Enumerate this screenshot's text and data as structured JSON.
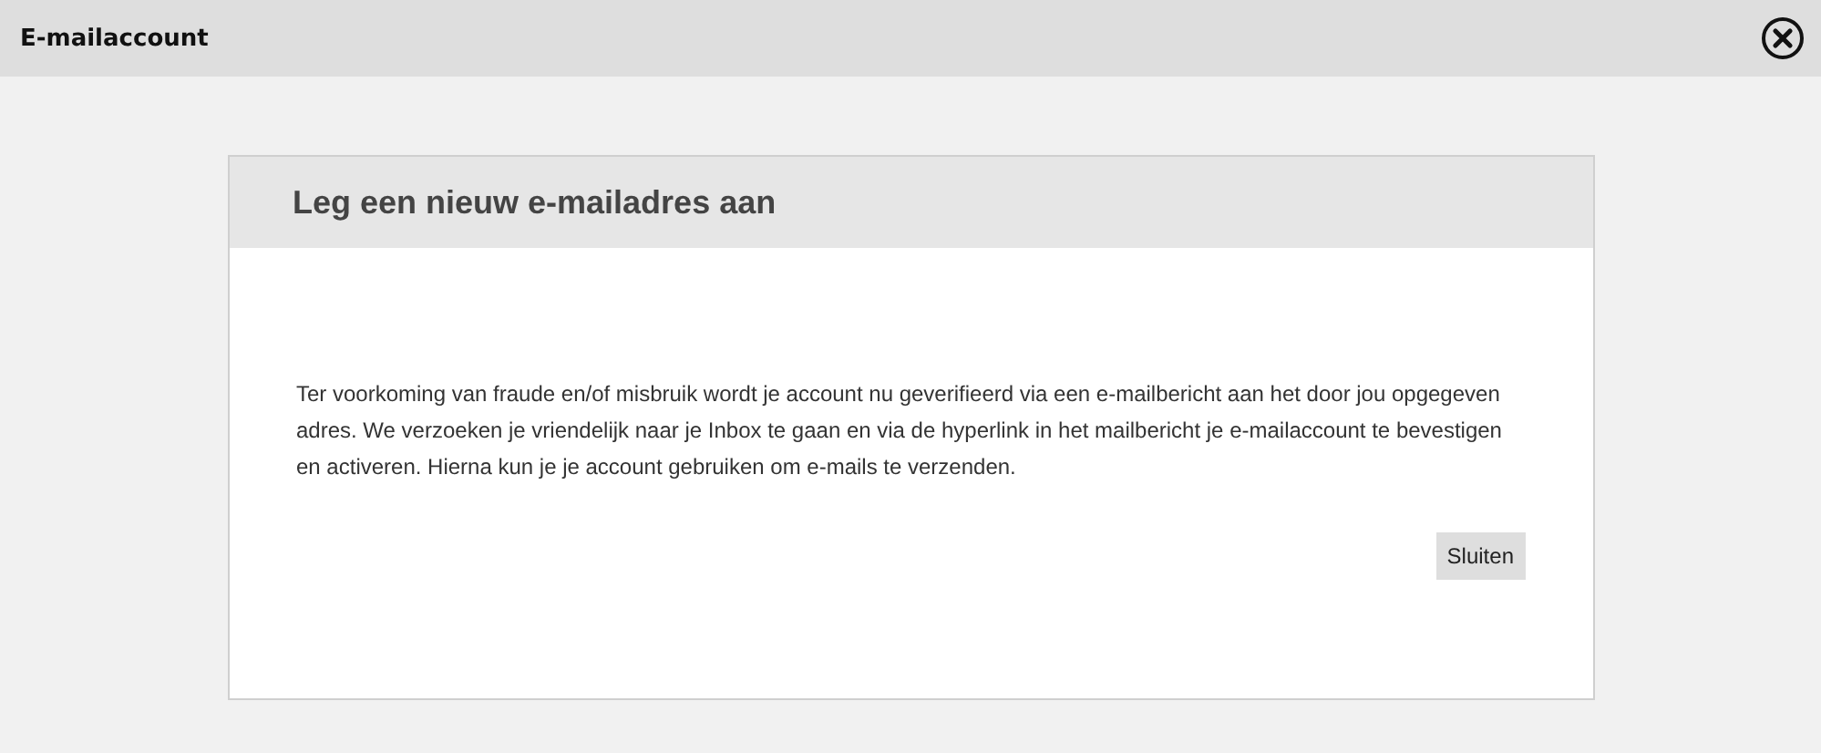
{
  "window": {
    "title": "E-mailaccount"
  },
  "dialog": {
    "title": "Leg een nieuw e-mailadres aan",
    "message": "Ter voorkoming van fraude en/of misbruik wordt je account nu geverifieerd via een e-mailbericht aan het door jou opgegeven adres. We verzoeken je vriendelijk naar je Inbox te gaan en via de hyperlink in het mailbericht je e-mailaccount te bevestigen en activeren. Hierna kun je je account gebruiken om e-mails te verzenden.",
    "buttons": [
      "Sluiten"
    ]
  }
}
